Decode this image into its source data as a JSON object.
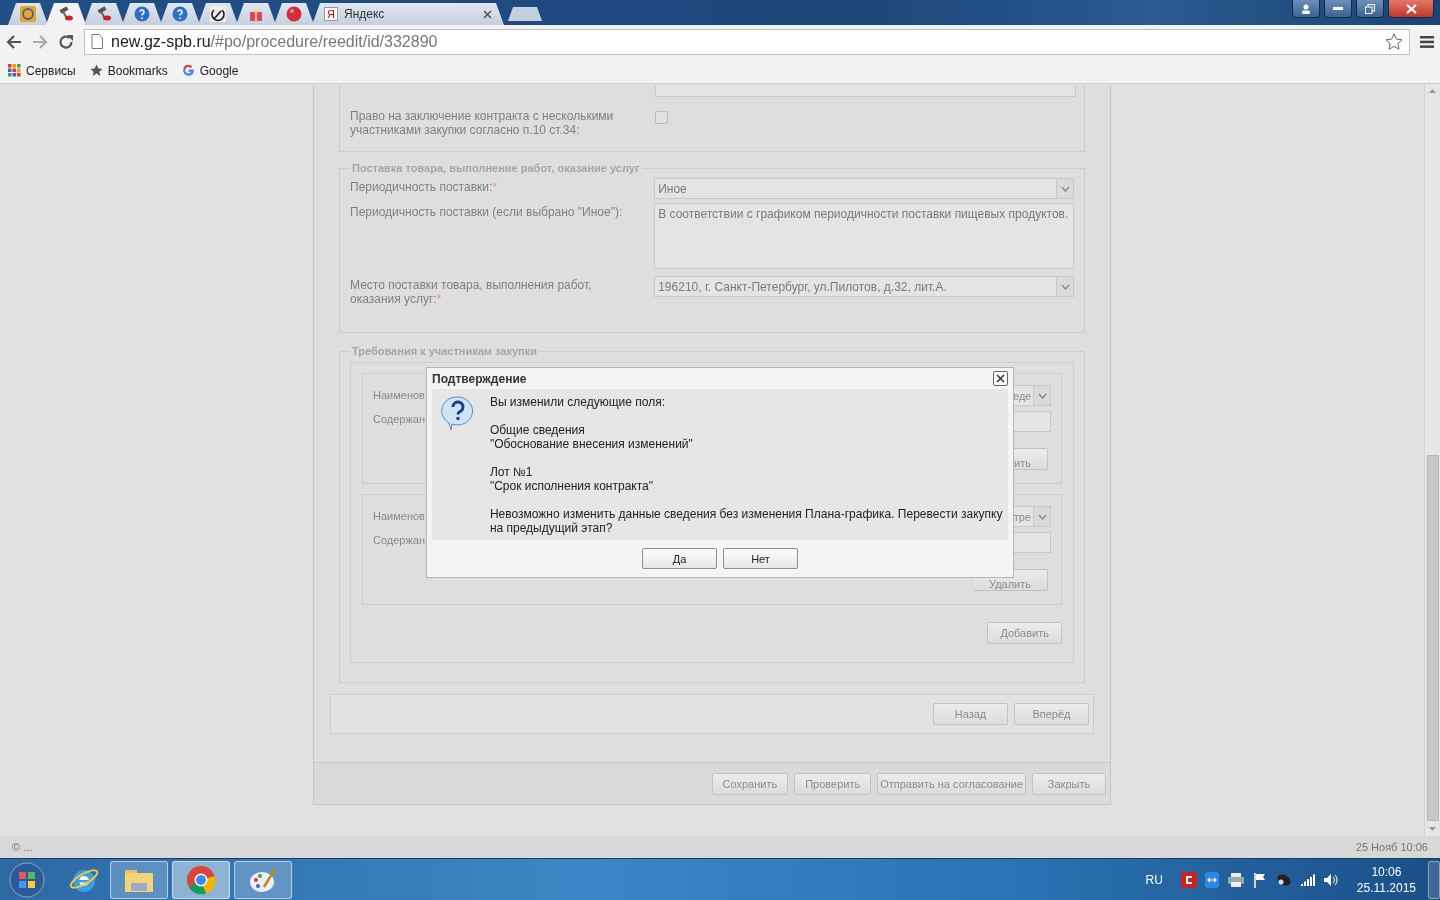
{
  "browser": {
    "tabs": [
      {
        "kind": "mail",
        "selected": false
      },
      {
        "kind": "hammer",
        "selected": true
      },
      {
        "kind": "hammer",
        "selected": false
      },
      {
        "kind": "question",
        "selected": false
      },
      {
        "kind": "question",
        "selected": false
      },
      {
        "kind": "sickle",
        "selected": false
      },
      {
        "kind": "gift",
        "selected": false
      },
      {
        "kind": "ball",
        "selected": false
      },
      {
        "kind": "page",
        "selected": false,
        "title": "Яндекс",
        "favicon": "Я"
      }
    ],
    "url_host": "new.gz-spb.ru",
    "url_path": "/#po/procedure/reedit/id/332890",
    "bookmarks": [
      {
        "kind": "apps",
        "label": "Сервисы"
      },
      {
        "kind": "star",
        "label": "Bookmarks"
      },
      {
        "kind": "google",
        "label": "Google"
      }
    ]
  },
  "form": {
    "multi_contract": {
      "label": "Право на заключение контракта с несколькими участниками закупки согласно п.10 ст.34:",
      "checked": false
    },
    "delivery": {
      "legend": "Поставка товара, выполнение работ, оказание услуг",
      "rows": [
        {
          "kind": "select",
          "label": "Периодичность поставки:",
          "required_mark": "*",
          "value": "Иное"
        },
        {
          "kind": "textarea",
          "label": "Периодичность поставки (если выбрано \"Иное\"):",
          "value": "В соответствии с графиком периодичности поставки пищевых продуктов."
        },
        {
          "kind": "select",
          "label": "Место поставки товара, выполнения работ, оказания услуг:",
          "required_mark": "*",
          "value": "196210, г. Санкт-Петербург, ул.Пилотов, д.32, лит.А."
        }
      ]
    },
    "requirements": {
      "legend": "Требования к участникам закупки",
      "items": [
        {
          "name_label": "Наименов",
          "content_label": "Содержан",
          "select_value": "еде",
          "button": "ить"
        },
        {
          "name_label": "Наименов",
          "content_label": "Содержан",
          "select_value": "тре",
          "button": "Удалить"
        }
      ],
      "add_button": "Добавить"
    },
    "nav_buttons": [
      "Назад",
      "Вперёд"
    ],
    "footer_buttons": [
      "Сохранить",
      "Проверить",
      "Отправить на согласование",
      "Закрыть"
    ]
  },
  "dialog": {
    "title": "Подтверждение",
    "paragraphs": [
      [
        "Вы изменили следующие поля:"
      ],
      [
        "Общие сведения",
        "\"Обоснование внесения изменений\""
      ],
      [
        "Лот №1",
        "\"Срок исполнения контракта\""
      ],
      [
        "Невозможно изменить данные сведения без изменения Плана-графика. Перевести закупку на предыдущий этап?"
      ]
    ],
    "buttons": [
      "Да",
      "Нет"
    ]
  },
  "status_bar": {
    "left": "© ...",
    "right": "25 Нояб 10:06"
  },
  "taskbar": {
    "apps": [
      {
        "kind": "ie",
        "selected": false
      },
      {
        "kind": "folder",
        "selected": false
      },
      {
        "kind": "chrome",
        "selected": true
      },
      {
        "kind": "paint",
        "selected": false
      }
    ],
    "language": "RU",
    "time": "10:06",
    "date": "25.11.2015"
  }
}
